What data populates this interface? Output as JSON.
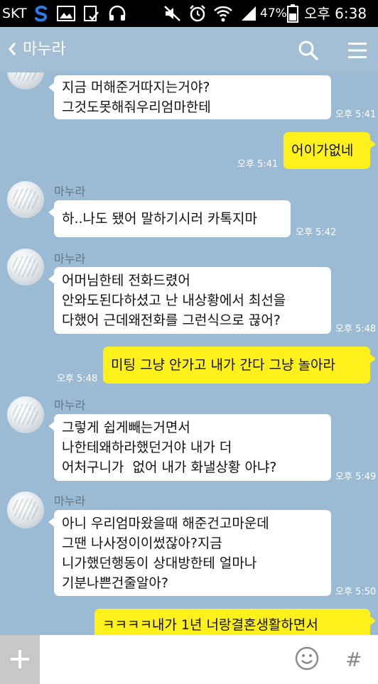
{
  "status_bar": {
    "carrier": "SKT",
    "battery": "47%",
    "time": "오후 6:38"
  },
  "header": {
    "title": "마누라",
    "back_icon": "chevron-left-icon",
    "search_icon": "search-icon",
    "menu_icon": "hamburger-menu-icon"
  },
  "messages": [
    {
      "side": "in",
      "sender": "",
      "text": "지금 머해준거따지는거야?\n그것도못해줘우리엄마한테",
      "time": "오후 5:41"
    },
    {
      "side": "out",
      "text": "어이가없네",
      "time": "오후 5:41"
    },
    {
      "side": "in",
      "sender": "마누라",
      "text": "하..나도 됐어 말하기시러 카톡지마",
      "time": "오후 5:42"
    },
    {
      "side": "in",
      "sender": "마누라",
      "text": "어머님한테 전화드렸어\n안와도된다하셨고 난 내상황에서 최선을\n다했어 근데왜전화를 그런식으로 끊어?",
      "time": "오후 5:48"
    },
    {
      "side": "out",
      "text": "미팅 그냥 안가고 내가 간다 그냥 놀아라",
      "time": "오후 5:48"
    },
    {
      "side": "in",
      "sender": "마누라",
      "text": "그렇게 쉽게빼는거면서\n나한테왜하라했던거야 내가 더\n어처구니가  없어 내가 화낼상황 아냐?",
      "time": "오후 5:49"
    },
    {
      "side": "in",
      "sender": "마누라",
      "text": "아니 우리엄마왔을때 해준건고마운데\n그땐 나사정이이썼잖아?지금\n니가했던행동이 상대방한테 얼마나\n기분나쁜건줄알아?",
      "time": "오후 5:50"
    },
    {
      "side": "out",
      "text": "ㅋㅋㅋㅋ내가 1년 너랑결혼생활하면서",
      "time": ""
    }
  ],
  "input_bar": {
    "plus_icon": "plus-icon",
    "emoji_icon": "emoji-icon",
    "hash_label": "#"
  },
  "colors": {
    "chat_background": "#9bbbd4",
    "my_bubble": "#fef01b",
    "their_bubble": "#ffffff"
  }
}
